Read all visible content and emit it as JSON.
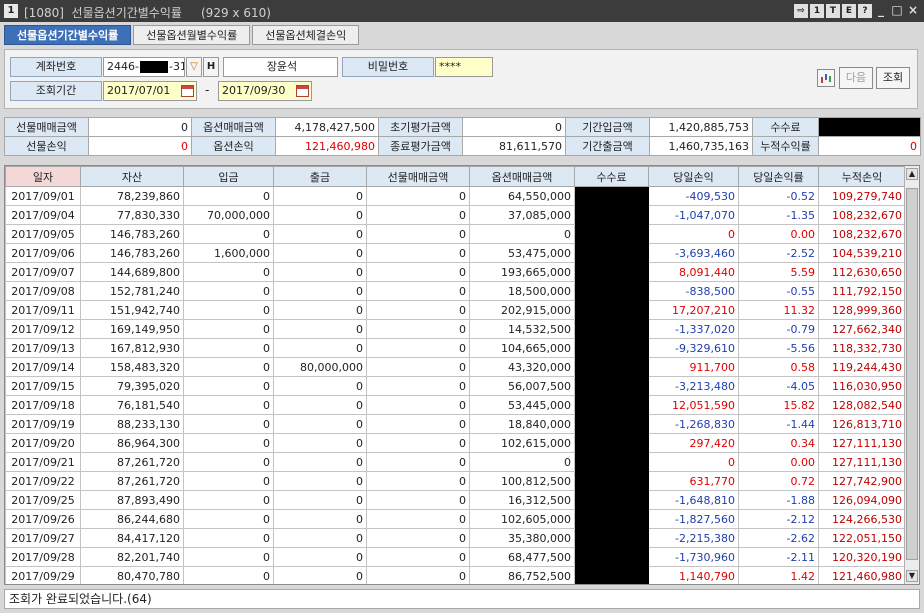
{
  "window": {
    "icon": "1",
    "title": "[1080]  선물옵션기간별수익률     (929 x 610)",
    "buttons": [
      "⇨",
      "1",
      "T",
      "E",
      "?"
    ],
    "min_label": "_",
    "max_label": "□",
    "close_label": "×"
  },
  "tabs": [
    {
      "label": "선물옵션기간별수익률",
      "active": true
    },
    {
      "label": "선물옵션월별수익률",
      "active": false
    },
    {
      "label": "선물옵션체결손익",
      "active": false
    }
  ],
  "form": {
    "account_label": "계좌번호",
    "account_prefix": "2446-",
    "account_suffix": "-31",
    "account_name": "장윤석",
    "password_label": "비밀번호",
    "password_value": "****",
    "period_label": "조회기간",
    "date_from": "2017/07/01",
    "date_sep": "-",
    "date_to": "2017/09/30",
    "next_label": "다음",
    "query_label": "조회"
  },
  "summary": {
    "row1": [
      {
        "label": "선물매매금액",
        "value": "0"
      },
      {
        "label": "옵션매매금액",
        "value": "4,178,427,500"
      },
      {
        "label": "초기평가금액",
        "value": "0"
      },
      {
        "label": "기간입금액",
        "value": "1,420,885,753"
      },
      {
        "label": "수수료",
        "value": ""
      }
    ],
    "row2": [
      {
        "label": "선물손익",
        "value": "0"
      },
      {
        "label": "옵션손익",
        "value": "121,460,980"
      },
      {
        "label": "종료평가금액",
        "value": "81,611,570"
      },
      {
        "label": "기간출금액",
        "value": "1,460,735,163"
      },
      {
        "label": "누적수익률",
        "value": "0"
      }
    ]
  },
  "table": {
    "columns": [
      "일자",
      "자산",
      "입금",
      "출금",
      "선물매매금액",
      "옵션매매금액",
      "수수료",
      "당일손익",
      "당일손익률",
      "누적손익"
    ],
    "rows": [
      [
        "2017/09/01",
        "78,239,860",
        "0",
        "0",
        "0",
        "64,550,000",
        "",
        "-409,530",
        "-0.52",
        "109,279,740"
      ],
      [
        "2017/09/04",
        "77,830,330",
        "70,000,000",
        "0",
        "0",
        "37,085,000",
        "",
        "-1,047,070",
        "-1.35",
        "108,232,670"
      ],
      [
        "2017/09/05",
        "146,783,260",
        "0",
        "0",
        "0",
        "0",
        "",
        "0",
        "0.00",
        "108,232,670"
      ],
      [
        "2017/09/06",
        "146,783,260",
        "1,600,000",
        "0",
        "0",
        "53,475,000",
        "",
        "-3,693,460",
        "-2.52",
        "104,539,210"
      ],
      [
        "2017/09/07",
        "144,689,800",
        "0",
        "0",
        "0",
        "193,665,000",
        "",
        "8,091,440",
        "5.59",
        "112,630,650"
      ],
      [
        "2017/09/08",
        "152,781,240",
        "0",
        "0",
        "0",
        "18,500,000",
        "",
        "-838,500",
        "-0.55",
        "111,792,150"
      ],
      [
        "2017/09/11",
        "151,942,740",
        "0",
        "0",
        "0",
        "202,915,000",
        "",
        "17,207,210",
        "11.32",
        "128,999,360"
      ],
      [
        "2017/09/12",
        "169,149,950",
        "0",
        "0",
        "0",
        "14,532,500",
        "",
        "-1,337,020",
        "-0.79",
        "127,662,340"
      ],
      [
        "2017/09/13",
        "167,812,930",
        "0",
        "0",
        "0",
        "104,665,000",
        "",
        "-9,329,610",
        "-5.56",
        "118,332,730"
      ],
      [
        "2017/09/14",
        "158,483,320",
        "0",
        "80,000,000",
        "0",
        "43,320,000",
        "",
        "911,700",
        "0.58",
        "119,244,430"
      ],
      [
        "2017/09/15",
        "79,395,020",
        "0",
        "0",
        "0",
        "56,007,500",
        "",
        "-3,213,480",
        "-4.05",
        "116,030,950"
      ],
      [
        "2017/09/18",
        "76,181,540",
        "0",
        "0",
        "0",
        "53,445,000",
        "",
        "12,051,590",
        "15.82",
        "128,082,540"
      ],
      [
        "2017/09/19",
        "88,233,130",
        "0",
        "0",
        "0",
        "18,840,000",
        "",
        "-1,268,830",
        "-1.44",
        "126,813,710"
      ],
      [
        "2017/09/20",
        "86,964,300",
        "0",
        "0",
        "0",
        "102,615,000",
        "",
        "297,420",
        "0.34",
        "127,111,130"
      ],
      [
        "2017/09/21",
        "87,261,720",
        "0",
        "0",
        "0",
        "0",
        "",
        "0",
        "0.00",
        "127,111,130"
      ],
      [
        "2017/09/22",
        "87,261,720",
        "0",
        "0",
        "0",
        "100,812,500",
        "",
        "631,770",
        "0.72",
        "127,742,900"
      ],
      [
        "2017/09/25",
        "87,893,490",
        "0",
        "0",
        "0",
        "16,312,500",
        "",
        "-1,648,810",
        "-1.88",
        "126,094,090"
      ],
      [
        "2017/09/26",
        "86,244,680",
        "0",
        "0",
        "0",
        "102,605,000",
        "",
        "-1,827,560",
        "-2.12",
        "124,266,530"
      ],
      [
        "2017/09/27",
        "84,417,120",
        "0",
        "0",
        "0",
        "35,380,000",
        "",
        "-2,215,380",
        "-2.62",
        "122,051,150"
      ],
      [
        "2017/09/28",
        "82,201,740",
        "0",
        "0",
        "0",
        "68,477,500",
        "",
        "-1,730,960",
        "-2.11",
        "120,320,190"
      ],
      [
        "2017/09/29",
        "80,470,780",
        "0",
        "0",
        "0",
        "86,752,500",
        "",
        "1,140,790",
        "1.42",
        "121,460,980"
      ]
    ]
  },
  "status": "조회가 완료되었습니다.(64)",
  "colors": {
    "positive": "#e00000",
    "negative": "#1f3fb0",
    "header": "#dde8f5",
    "active_tab": "#3e70b8"
  }
}
